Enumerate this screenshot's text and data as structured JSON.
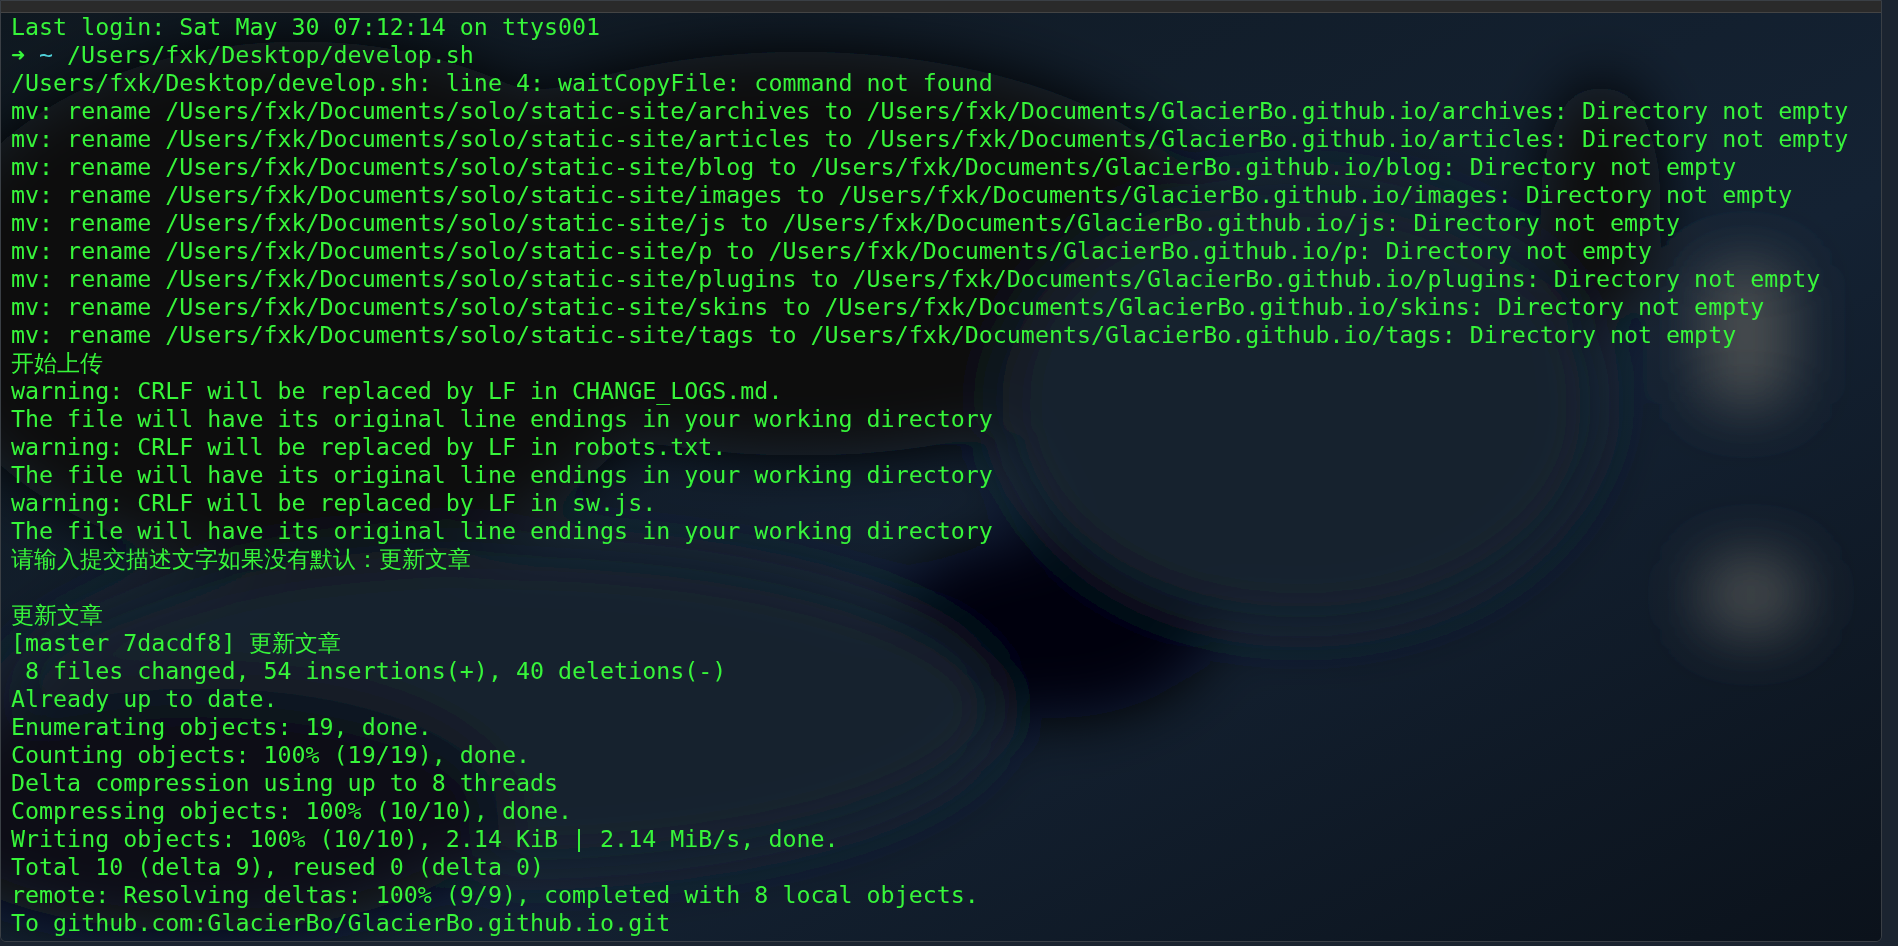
{
  "terminal": {
    "lines": [
      {
        "kind": "output",
        "text": "Last login: Sat May 30 07:12:14 on ttys001"
      },
      {
        "kind": "prompt",
        "symbol": "➜",
        "cwd": "~",
        "command": "/Users/fxk/Desktop/develop.sh"
      },
      {
        "kind": "output",
        "text": "/Users/fxk/Desktop/develop.sh: line 4: waitCopyFile: command not found"
      },
      {
        "kind": "output",
        "text": "mv: rename /Users/fxk/Documents/solo/static-site/archives to /Users/fxk/Documents/GlacierBo.github.io/archives: Directory not empty"
      },
      {
        "kind": "output",
        "text": "mv: rename /Users/fxk/Documents/solo/static-site/articles to /Users/fxk/Documents/GlacierBo.github.io/articles: Directory not empty"
      },
      {
        "kind": "output",
        "text": "mv: rename /Users/fxk/Documents/solo/static-site/blog to /Users/fxk/Documents/GlacierBo.github.io/blog: Directory not empty"
      },
      {
        "kind": "output",
        "text": "mv: rename /Users/fxk/Documents/solo/static-site/images to /Users/fxk/Documents/GlacierBo.github.io/images: Directory not empty"
      },
      {
        "kind": "output",
        "text": "mv: rename /Users/fxk/Documents/solo/static-site/js to /Users/fxk/Documents/GlacierBo.github.io/js: Directory not empty"
      },
      {
        "kind": "output",
        "text": "mv: rename /Users/fxk/Documents/solo/static-site/p to /Users/fxk/Documents/GlacierBo.github.io/p: Directory not empty"
      },
      {
        "kind": "output",
        "text": "mv: rename /Users/fxk/Documents/solo/static-site/plugins to /Users/fxk/Documents/GlacierBo.github.io/plugins: Directory not empty"
      },
      {
        "kind": "output",
        "text": "mv: rename /Users/fxk/Documents/solo/static-site/skins to /Users/fxk/Documents/GlacierBo.github.io/skins: Directory not empty"
      },
      {
        "kind": "output",
        "text": "mv: rename /Users/fxk/Documents/solo/static-site/tags to /Users/fxk/Documents/GlacierBo.github.io/tags: Directory not empty"
      },
      {
        "kind": "output",
        "text": "开始上传"
      },
      {
        "kind": "output",
        "text": "warning: CRLF will be replaced by LF in CHANGE_LOGS.md."
      },
      {
        "kind": "output",
        "text": "The file will have its original line endings in your working directory"
      },
      {
        "kind": "output",
        "text": "warning: CRLF will be replaced by LF in robots.txt."
      },
      {
        "kind": "output",
        "text": "The file will have its original line endings in your working directory"
      },
      {
        "kind": "output",
        "text": "warning: CRLF will be replaced by LF in sw.js."
      },
      {
        "kind": "output",
        "text": "The file will have its original line endings in your working directory"
      },
      {
        "kind": "output",
        "text": "请输入提交描述文字如果没有默认：更新文章"
      },
      {
        "kind": "blank"
      },
      {
        "kind": "output",
        "text": "更新文章"
      },
      {
        "kind": "output",
        "text": "[master 7dacdf8] 更新文章"
      },
      {
        "kind": "output",
        "text": " 8 files changed, 54 insertions(+), 40 deletions(-)"
      },
      {
        "kind": "output",
        "text": "Already up to date."
      },
      {
        "kind": "output",
        "text": "Enumerating objects: 19, done."
      },
      {
        "kind": "output",
        "text": "Counting objects: 100% (19/19), done."
      },
      {
        "kind": "output",
        "text": "Delta compression using up to 8 threads"
      },
      {
        "kind": "output",
        "text": "Compressing objects: 100% (10/10), done."
      },
      {
        "kind": "output",
        "text": "Writing objects: 100% (10/10), 2.14 KiB | 2.14 MiB/s, done."
      },
      {
        "kind": "output",
        "text": "Total 10 (delta 9), reused 0 (delta 0)"
      },
      {
        "kind": "output",
        "text": "remote: Resolving deltas: 100% (9/9), completed with 8 local objects."
      },
      {
        "kind": "output",
        "text": "To github.com:GlacierBo/GlacierBo.github.io.git"
      }
    ]
  }
}
